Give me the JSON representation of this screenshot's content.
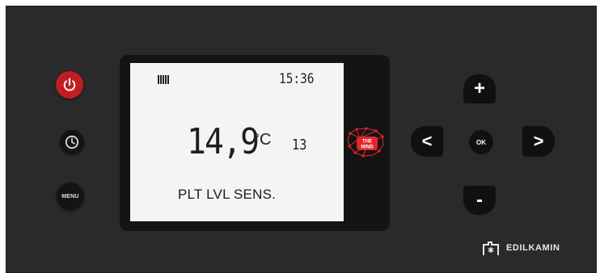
{
  "lcd": {
    "time": "15:36",
    "temperature": "14,9",
    "unit": "°C",
    "aux_value": "13",
    "message": "PLT LVL SENS."
  },
  "left_buttons": {
    "power_icon": "power-icon",
    "clock_icon": "clock-icon",
    "menu_label": "MENU"
  },
  "nav": {
    "up": "+",
    "down": "-",
    "left": "<",
    "right": ">",
    "ok": "OK"
  },
  "logos": {
    "mind_line1": "THE",
    "mind_line2": "MIND",
    "brand": "EDILKAMIN"
  },
  "colors": {
    "panel": "#2a2a2c",
    "power": "#c21d22",
    "lcd_bg": "#f4f4f2",
    "mind_red": "#e3262b"
  }
}
